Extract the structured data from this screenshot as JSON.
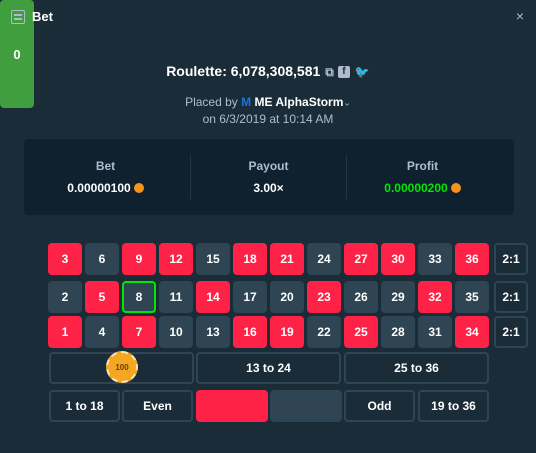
{
  "header": {
    "title": "Bet",
    "close": "×"
  },
  "bet_info": {
    "game": "Roulette",
    "bet_id": "6,078,308,581",
    "placed_by": "Placed by",
    "user_prefix": "M",
    "user": "ME AlphaStorm",
    "date": "on 6/3/2019 at 10:14 AM"
  },
  "stats": {
    "bet_label": "Bet",
    "bet_value": "0.00000100",
    "payout_label": "Payout",
    "payout_value": "3.00×",
    "profit_label": "Profit",
    "profit_value": "0.00000200",
    "profit_color": "#00e701"
  },
  "table": {
    "zero": "0",
    "rows": [
      [
        {
          "n": "3",
          "c": "red"
        },
        {
          "n": "6",
          "c": "black"
        },
        {
          "n": "9",
          "c": "red"
        },
        {
          "n": "12",
          "c": "red"
        },
        {
          "n": "15",
          "c": "black"
        },
        {
          "n": "18",
          "c": "red"
        },
        {
          "n": "21",
          "c": "red"
        },
        {
          "n": "24",
          "c": "black"
        },
        {
          "n": "27",
          "c": "red"
        },
        {
          "n": "30",
          "c": "red"
        },
        {
          "n": "33",
          "c": "black"
        },
        {
          "n": "36",
          "c": "red"
        }
      ],
      [
        {
          "n": "2",
          "c": "black"
        },
        {
          "n": "5",
          "c": "red"
        },
        {
          "n": "8",
          "c": "black",
          "selected": true
        },
        {
          "n": "11",
          "c": "black"
        },
        {
          "n": "14",
          "c": "red"
        },
        {
          "n": "17",
          "c": "black"
        },
        {
          "n": "20",
          "c": "black"
        },
        {
          "n": "23",
          "c": "red"
        },
        {
          "n": "26",
          "c": "black"
        },
        {
          "n": "29",
          "c": "black"
        },
        {
          "n": "32",
          "c": "red"
        },
        {
          "n": "35",
          "c": "black"
        }
      ],
      [
        {
          "n": "1",
          "c": "red"
        },
        {
          "n": "4",
          "c": "black"
        },
        {
          "n": "7",
          "c": "red"
        },
        {
          "n": "10",
          "c": "black"
        },
        {
          "n": "13",
          "c": "black"
        },
        {
          "n": "16",
          "c": "red"
        },
        {
          "n": "19",
          "c": "red"
        },
        {
          "n": "22",
          "c": "black"
        },
        {
          "n": "25",
          "c": "red"
        },
        {
          "n": "28",
          "c": "black"
        },
        {
          "n": "31",
          "c": "black"
        },
        {
          "n": "34",
          "c": "red"
        }
      ]
    ],
    "columns": [
      "2:1",
      "2:1",
      "2:1"
    ],
    "dozens": [
      "",
      "13 to 24",
      "25 to 36"
    ],
    "chip": "100",
    "bottom": [
      "1 to 18",
      "Even",
      "",
      "",
      "Odd",
      "19 to 36"
    ],
    "colors": {
      "red": "#fe2247",
      "black": "#2f4553",
      "green": "#419e3f",
      "highlight": "#00e701"
    }
  }
}
